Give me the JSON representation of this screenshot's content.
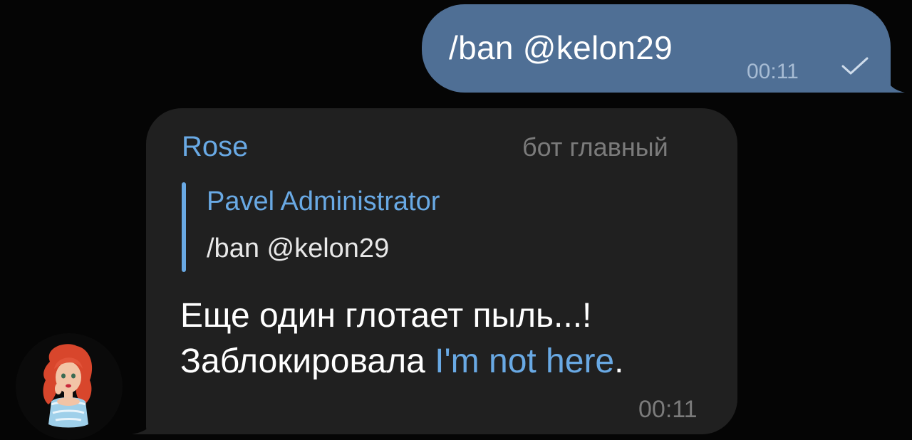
{
  "outgoing": {
    "text": "/ban @kelon29",
    "time": "00:11",
    "status_icon": "single-check-icon"
  },
  "incoming": {
    "sender_name": "Rose",
    "sender_role": "бот главный",
    "reply": {
      "author": "Pavel Administrator",
      "text": "/ban @kelon29"
    },
    "line1": "Еще один глотает пыль...!",
    "line2_prefix": "Заблокировала ",
    "line2_link": "I'm not here",
    "line2_suffix": ".",
    "time": "00:11"
  },
  "avatar": {
    "icon": "cartoon-redhead-avatar"
  },
  "colors": {
    "background": "#050505",
    "outgoing_bubble": "#4f6f95",
    "incoming_bubble": "#202020",
    "accent": "#69a9e4",
    "muted_text": "#7b7b7b"
  }
}
